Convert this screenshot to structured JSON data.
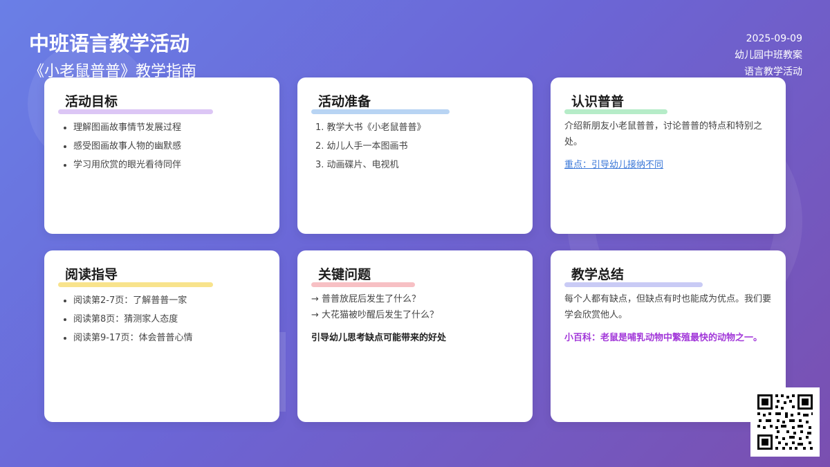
{
  "header": {
    "title": "中班语言教学活动",
    "subtitle": "《小老鼠普普》教学指南",
    "date": "2025-09-09",
    "category": "幼儿园中班教案",
    "activity_type": "语言教学活动"
  },
  "cards": {
    "goals": {
      "title": "活动目标",
      "accent": "#dcc6f5",
      "items": [
        "理解图画故事情节发展过程",
        "感受图画故事人物的幽默感",
        "学习用欣赏的眼光看待同伴"
      ]
    },
    "prep": {
      "title": "活动准备",
      "accent": "#b8d4f3",
      "items": [
        "1. 教学大书《小老鼠普普》",
        "2. 幼儿人手一本图画书",
        "3. 动画碟片、电视机"
      ]
    },
    "meet": {
      "title": "认识普普",
      "accent": "#b6ecc8",
      "text": "介绍新朋友小老鼠普普，讨论普普的特点和特别之处。",
      "link": "重点：引导幼儿接纳不同"
    },
    "reading": {
      "title": "阅读指导",
      "accent": "#f8e38c",
      "items": [
        "阅读第2-7页：了解普普一家",
        "阅读第8页：猜测家人态度",
        "阅读第9-17页：体会普普心情"
      ]
    },
    "questions": {
      "title": "关键问题",
      "accent": "#f7c0c4",
      "q1": "→ 普普放屁后发生了什么？",
      "q2": "→ 大花猫被吵醒后发生了什么？",
      "note": "引导幼儿思考缺点可能带来的好处"
    },
    "summary": {
      "title": "教学总结",
      "accent": "#c9cbf5",
      "text": "每个人都有缺点，但缺点有时也能成为优点。我们要学会欣赏他人。",
      "fact": "小百科：老鼠是哺乳动物中繁殖最快的动物之一。"
    }
  }
}
